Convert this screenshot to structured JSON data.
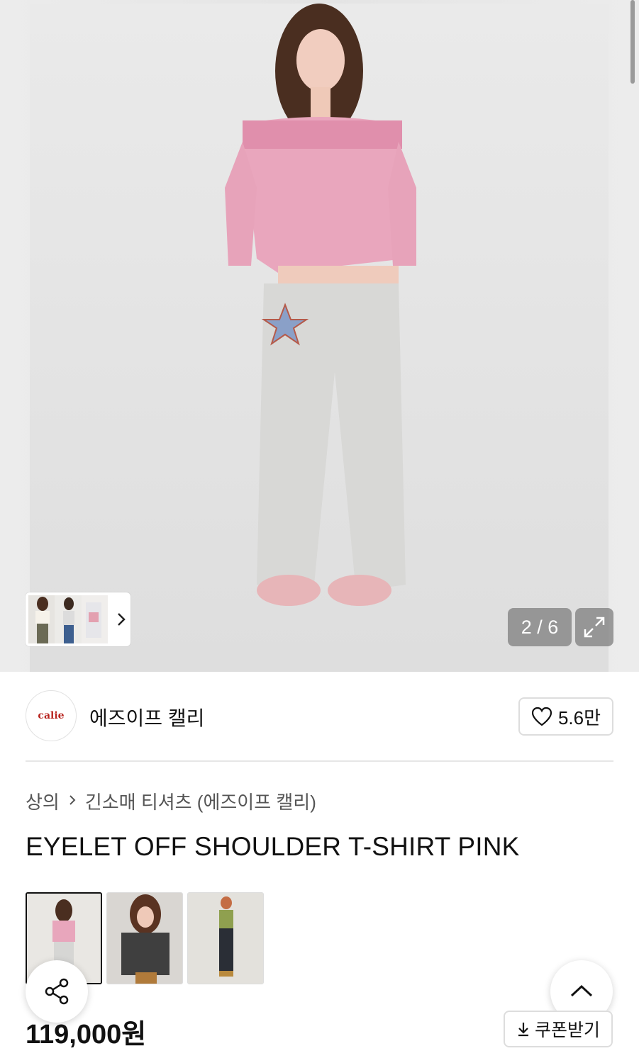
{
  "gallery": {
    "counter": "2 / 6",
    "current_index": 2,
    "total": 6
  },
  "brand": {
    "logo_text": "calie",
    "name": "에즈이프 캘리",
    "likes": "5.6만"
  },
  "breadcrumb": {
    "category": "상의",
    "subcategory": "긴소매 티셔츠 (에즈이프 캘리)"
  },
  "product": {
    "title": "EYELET OFF SHOULDER T-SHIRT PINK",
    "price": "119,000원"
  },
  "actions": {
    "coupon_label": "쿠폰받기"
  },
  "icons": {
    "expand": "expand-icon",
    "heart": "heart-icon",
    "share": "share-icon",
    "scroll_top": "chevron-up-icon",
    "download": "download-icon",
    "next": "chevron-right-icon"
  },
  "colors": {
    "brand_logo": "#b8241f",
    "overlay": "#828282"
  }
}
